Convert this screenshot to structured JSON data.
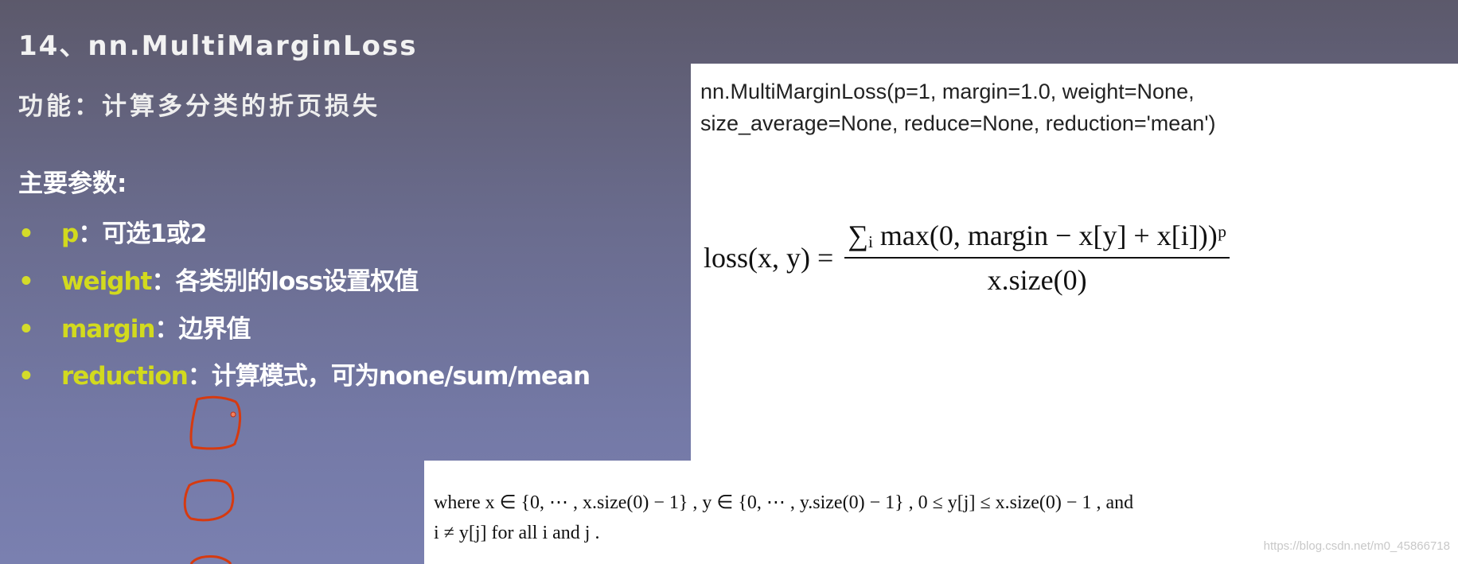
{
  "slide": {
    "title": "14、nn.MultiMarginLoss",
    "function_line": "功能：计算多分类的折页损失",
    "params_heading": "主要参数:",
    "bullets": [
      {
        "key": "p",
        "text": "：可选1或2"
      },
      {
        "key": "weight",
        "text": "：各类别的loss设置权值"
      },
      {
        "key": "margin",
        "text": "：边界值"
      },
      {
        "key": "reduction",
        "text": "：计算模式，可为none/sum/mean"
      }
    ],
    "accent_color": "#d2da1e",
    "annotation_color": "#d63a10"
  },
  "doc": {
    "signature_line1": "nn.MultiMarginLoss(p=1, margin=1.0, weight=None,",
    "signature_line2": "size_average=None, reduce=None, reduction='mean')",
    "formula_lhs": "loss(x, y) =",
    "formula_numerator": "∑ᵢ max(0, margin − x[y] + x[i]))ᵖ",
    "formula_denominator": "x.size(0)",
    "condition_line1": "where x ∈ {0, ⋯ , x.size(0) − 1} , y ∈ {0, ⋯ , y.size(0) − 1} , 0 ≤ y[j] ≤ x.size(0) − 1 , and",
    "condition_line2": "i ≠ y[j] for all i and j .",
    "watermark": "https://blog.csdn.net/m0_45866718"
  }
}
